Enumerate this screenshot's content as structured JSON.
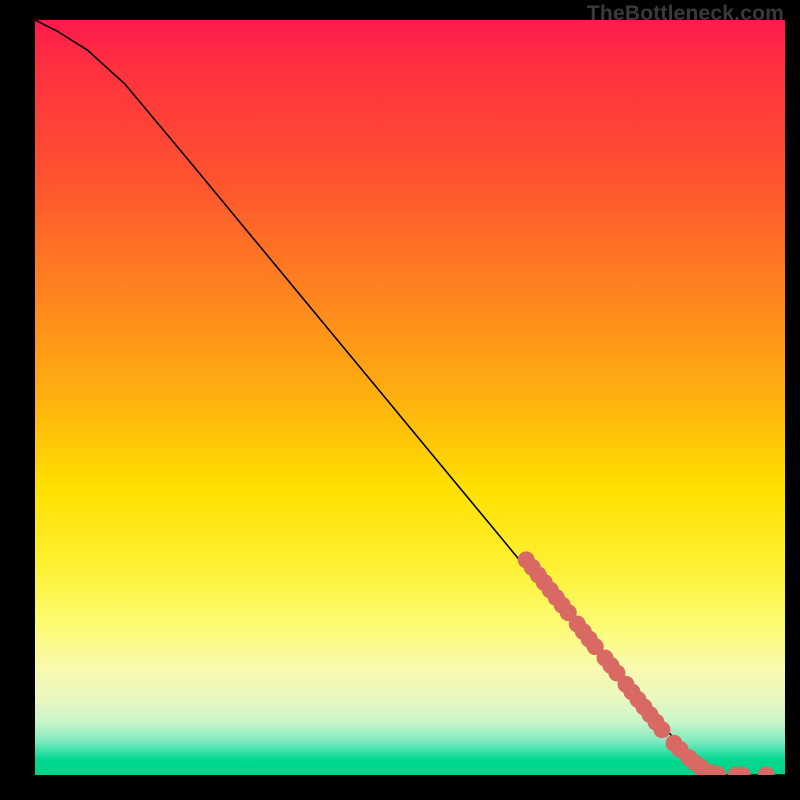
{
  "watermark": "TheBottleneck.com",
  "colors": {
    "marker": "#d86a63",
    "curve": "#000000",
    "background_top": "#ff1a4d",
    "background_bottom": "#00d488"
  },
  "chart_data": {
    "type": "line",
    "title": "",
    "xlabel": "",
    "ylabel": "",
    "xlim": [
      0,
      100
    ],
    "ylim": [
      0,
      100
    ],
    "curve": [
      {
        "x": 0,
        "y": 100
      },
      {
        "x": 3,
        "y": 98.5
      },
      {
        "x": 7,
        "y": 96
      },
      {
        "x": 12,
        "y": 91.5
      },
      {
        "x": 20,
        "y": 82
      },
      {
        "x": 30,
        "y": 70
      },
      {
        "x": 40,
        "y": 58
      },
      {
        "x": 50,
        "y": 46
      },
      {
        "x": 60,
        "y": 34
      },
      {
        "x": 70,
        "y": 22
      },
      {
        "x": 80,
        "y": 10.5
      },
      {
        "x": 86,
        "y": 4
      },
      {
        "x": 89,
        "y": 1.2
      },
      {
        "x": 92,
        "y": 0
      },
      {
        "x": 100,
        "y": 0
      }
    ],
    "series": [
      {
        "name": "markers",
        "points": [
          {
            "x": 65.5,
            "y": 28.5
          },
          {
            "x": 66.3,
            "y": 27.5
          },
          {
            "x": 67.1,
            "y": 26.5
          },
          {
            "x": 67.9,
            "y": 25.5
          },
          {
            "x": 68.7,
            "y": 24.5
          },
          {
            "x": 69.5,
            "y": 23.5
          },
          {
            "x": 70.3,
            "y": 22.5
          },
          {
            "x": 71.1,
            "y": 21.5
          },
          {
            "x": 72.3,
            "y": 20.0
          },
          {
            "x": 73.1,
            "y": 19.0
          },
          {
            "x": 73.9,
            "y": 18.0
          },
          {
            "x": 74.7,
            "y": 17.0
          },
          {
            "x": 76.0,
            "y": 15.5
          },
          {
            "x": 76.8,
            "y": 14.5
          },
          {
            "x": 77.6,
            "y": 13.5
          },
          {
            "x": 78.8,
            "y": 12.0
          },
          {
            "x": 79.6,
            "y": 11.0
          },
          {
            "x": 80.4,
            "y": 10.0
          },
          {
            "x": 81.2,
            "y": 9.0
          },
          {
            "x": 82.0,
            "y": 8.0
          },
          {
            "x": 82.8,
            "y": 7.0
          },
          {
            "x": 83.6,
            "y": 6.0
          },
          {
            "x": 85.2,
            "y": 4.2
          },
          {
            "x": 86.0,
            "y": 3.4
          },
          {
            "x": 87.2,
            "y": 2.3
          },
          {
            "x": 88.0,
            "y": 1.6
          },
          {
            "x": 88.8,
            "y": 1.0
          },
          {
            "x": 90.2,
            "y": 0.3
          },
          {
            "x": 91.0,
            "y": 0.1
          },
          {
            "x": 93.5,
            "y": 0.0
          },
          {
            "x": 94.3,
            "y": 0.0
          },
          {
            "x": 97.5,
            "y": 0.0
          }
        ]
      }
    ]
  }
}
